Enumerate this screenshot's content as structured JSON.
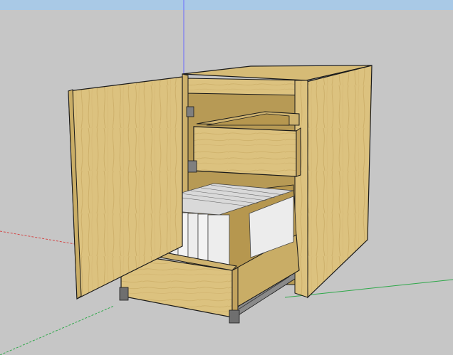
{
  "app": "sketchup-modeling-viewport",
  "viewport": {
    "sky_color": "#a9c9e6",
    "ground_color": "#c6c6c6"
  },
  "axes": {
    "red_color": "#d24a4a",
    "green_color": "#2fa84a",
    "blue_color": "#6b6bff"
  },
  "model": {
    "object": "base-cabinet-with-open-door-and-two-drawers",
    "wood_color": "#dcc27f",
    "wood_dark_color": "#c9ad66",
    "edge_color": "#1a1a1a",
    "book_color": "#ececec",
    "book_count": 9,
    "slide_color": "#8a8a8a"
  }
}
